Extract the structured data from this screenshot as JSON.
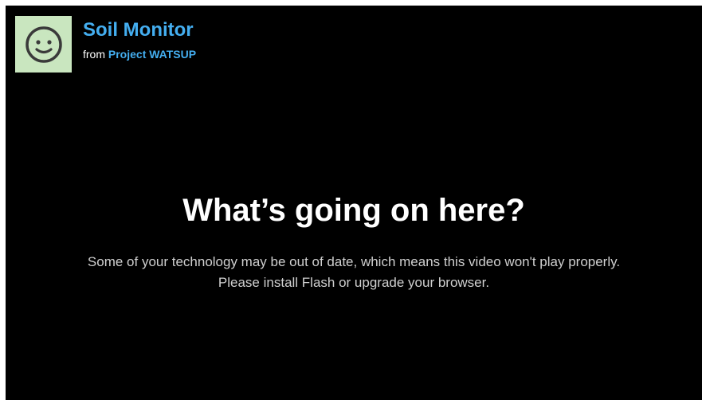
{
  "video": {
    "title": "Soil Monitor",
    "from_prefix": "from",
    "channel": "Project WATSUP",
    "avatar_icon": "smiley-face-icon"
  },
  "message": {
    "title": "What’s going on here?",
    "body": "Some of your technology may be out of date, which means this video won't play properly. Please install Flash or upgrade your browser."
  },
  "colors": {
    "background": "#000000",
    "link": "#44aef0",
    "avatar_bg": "#c9e6bf"
  }
}
